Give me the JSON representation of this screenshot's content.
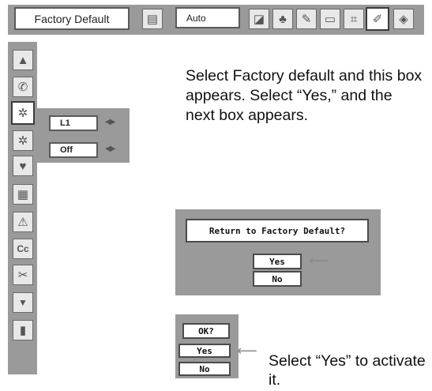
{
  "toolbar": {
    "menu_title": "Factory Default",
    "value": "Auto",
    "icons": [
      {
        "name": "image-adjust-icon",
        "glyph": "▤"
      },
      {
        "name": "pc-adjust-icon",
        "glyph": "◪"
      },
      {
        "name": "color-adjust-icon",
        "glyph": "♣"
      },
      {
        "name": "screen-adjust-icon",
        "glyph": "✎"
      },
      {
        "name": "setting-icon",
        "glyph": "▭"
      },
      {
        "name": "information-icon",
        "glyph": "⌗"
      },
      {
        "name": "factory-default-icon",
        "glyph": "✐",
        "selected": true
      },
      {
        "name": "display-icon",
        "glyph": "◈"
      }
    ]
  },
  "sidebar": {
    "items": [
      {
        "name": "move-up-icon",
        "glyph": "▲"
      },
      {
        "name": "wrench-icon",
        "glyph": "✆"
      },
      {
        "name": "fan-control-icon",
        "glyph": "✲",
        "selected": true
      },
      {
        "name": "fan-icon",
        "glyph": "✲"
      },
      {
        "name": "lamp-icon",
        "glyph": "♥"
      },
      {
        "name": "filter-icon",
        "glyph": "▦"
      },
      {
        "name": "warning-icon",
        "glyph": "⚠"
      },
      {
        "name": "closed-caption-icon",
        "glyph": "Cc"
      },
      {
        "name": "tools-icon",
        "glyph": "✂"
      },
      {
        "name": "move-down-icon",
        "glyph": "▼"
      },
      {
        "name": "exit-icon",
        "glyph": "▮"
      }
    ]
  },
  "submenu": {
    "option1": "L1",
    "option2": "Off",
    "arrows": "◀▶"
  },
  "description": {
    "main": "Select Factory default and this box appears.  Select “Yes,” and the next box appears.",
    "activate": "Select “Yes” to activate it."
  },
  "confirm_dialog": {
    "question": "Return to Factory Default?",
    "yes": "Yes",
    "no": "No",
    "pointer": "⟵"
  },
  "ok_dialog": {
    "title": "OK?",
    "yes": "Yes",
    "no": "No",
    "pointer": "⟵"
  }
}
